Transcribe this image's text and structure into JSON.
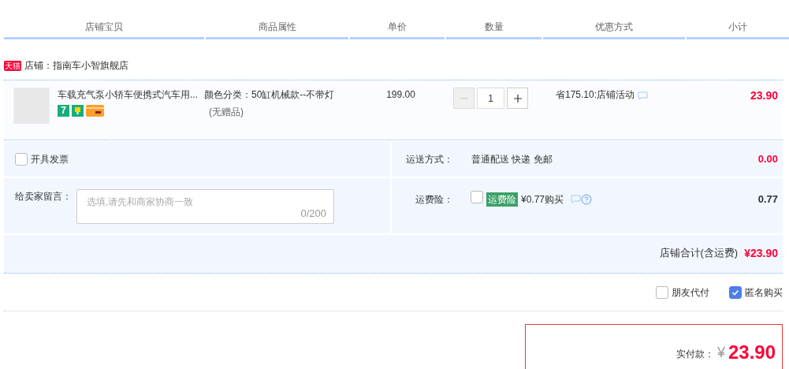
{
  "columns": [
    "店铺宝贝",
    "商品属性",
    "单价",
    "数量",
    "优惠方式",
    "小计"
  ],
  "shop": {
    "badge": "天猫",
    "label": "店铺：指南车小智旗舰店"
  },
  "item": {
    "title": "车载充气泵小轿车便携式汽车用...",
    "service_tag": "7",
    "attributes": [
      "颜色分类：50缸机械款--不带灯",
      "(无赠品)"
    ],
    "price": "199.00",
    "quantity": {
      "value": "1",
      "minus_disabled": true
    },
    "discount": "省175.10:店铺活动",
    "subtotal": "23.90"
  },
  "invoice": {
    "label": "开具发票",
    "checked": false
  },
  "message": {
    "label": "给卖家留言：",
    "placeholder": "选填,请先和商家协商一致",
    "counter": "0/200"
  },
  "shipping": {
    "label": "运送方式：",
    "value": "普通配送 快递 免邮",
    "amount": "0.00"
  },
  "insurance": {
    "label": "运费险：",
    "checked": false,
    "tag": "运费险",
    "price": "¥0.77购买",
    "amount": "0.77"
  },
  "shop_total": {
    "label": "店铺合计(含运费)",
    "amount": "¥23.90"
  },
  "options": [
    {
      "label": "朋友代付",
      "checked": false
    },
    {
      "label": "匿名购买",
      "checked": true
    }
  ],
  "payment": {
    "label": "实付款：",
    "currency": "¥",
    "amount": "23.90"
  }
}
